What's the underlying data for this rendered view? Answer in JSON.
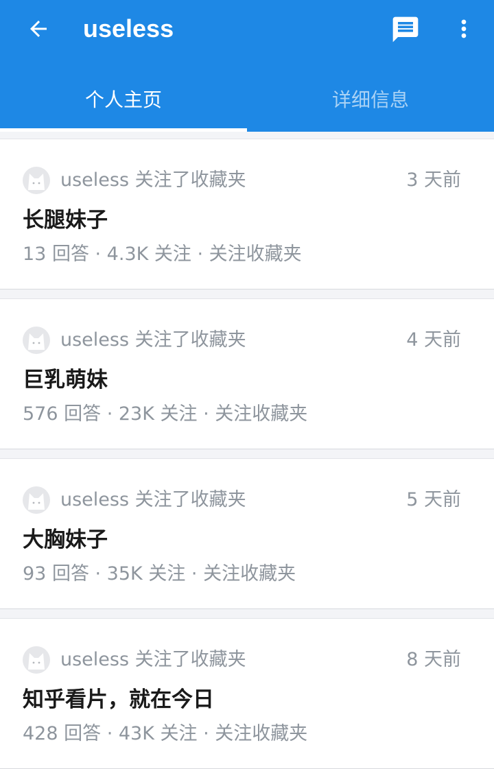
{
  "appbar": {
    "title": "useless",
    "colors": {
      "primary": "#1e88e5",
      "tab_inactive": "rgba(255,255,255,0.62)"
    },
    "icons": {
      "back": "arrow-left-icon",
      "message": "message-icon",
      "more": "more-vert-icon"
    }
  },
  "tabs": [
    {
      "label": "个人主页",
      "active": true
    },
    {
      "label": "详细信息",
      "active": false
    }
  ],
  "feed": {
    "items": [
      {
        "user": "useless",
        "action": "关注了收藏夹",
        "time": "3 天前",
        "title": "长腿妹子",
        "stats": "13 回答 · 4.3K 关注 · 关注收藏夹"
      },
      {
        "user": "useless",
        "action": "关注了收藏夹",
        "time": "4 天前",
        "title": "巨乳萌妹",
        "stats": "576 回答 · 23K 关注 · 关注收藏夹"
      },
      {
        "user": "useless",
        "action": "关注了收藏夹",
        "time": "5 天前",
        "title": "大胸妹子",
        "stats": "93 回答 · 35K 关注 · 关注收藏夹"
      },
      {
        "user": "useless",
        "action": "关注了收藏夹",
        "time": "8 天前",
        "title": "知乎看片，就在今日",
        "stats": "428 回答 · 43K 关注 · 关注收藏夹"
      }
    ]
  }
}
